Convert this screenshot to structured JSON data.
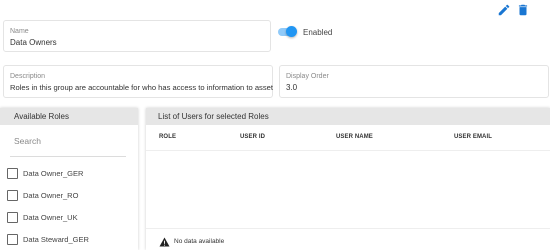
{
  "form": {
    "name_label": "Name",
    "name_value": "Data Owners",
    "enabled_label": "Enabled",
    "enabled_on": true,
    "description_label": "Description",
    "description_value": "Roles in this group are accountable for who has access to information to asset",
    "display_order_label": "Display Order",
    "display_order_value": "3.0"
  },
  "toolbar": {
    "icons": [
      "edit-pencil-icon",
      "delete-trash-icon"
    ],
    "accent": "#1976d2"
  },
  "available_roles": {
    "title": "Available Roles",
    "search_placeholder": "Search",
    "items": [
      "Data Owner_GER",
      "Data Owner_RO",
      "Data Owner_UK",
      "Data Steward_GER"
    ]
  },
  "users_table": {
    "title": "List of Users for selected Roles",
    "columns": [
      "ROLE",
      "USER ID",
      "USER NAME",
      "USER EMAIL"
    ],
    "empty_text": "No data available"
  }
}
